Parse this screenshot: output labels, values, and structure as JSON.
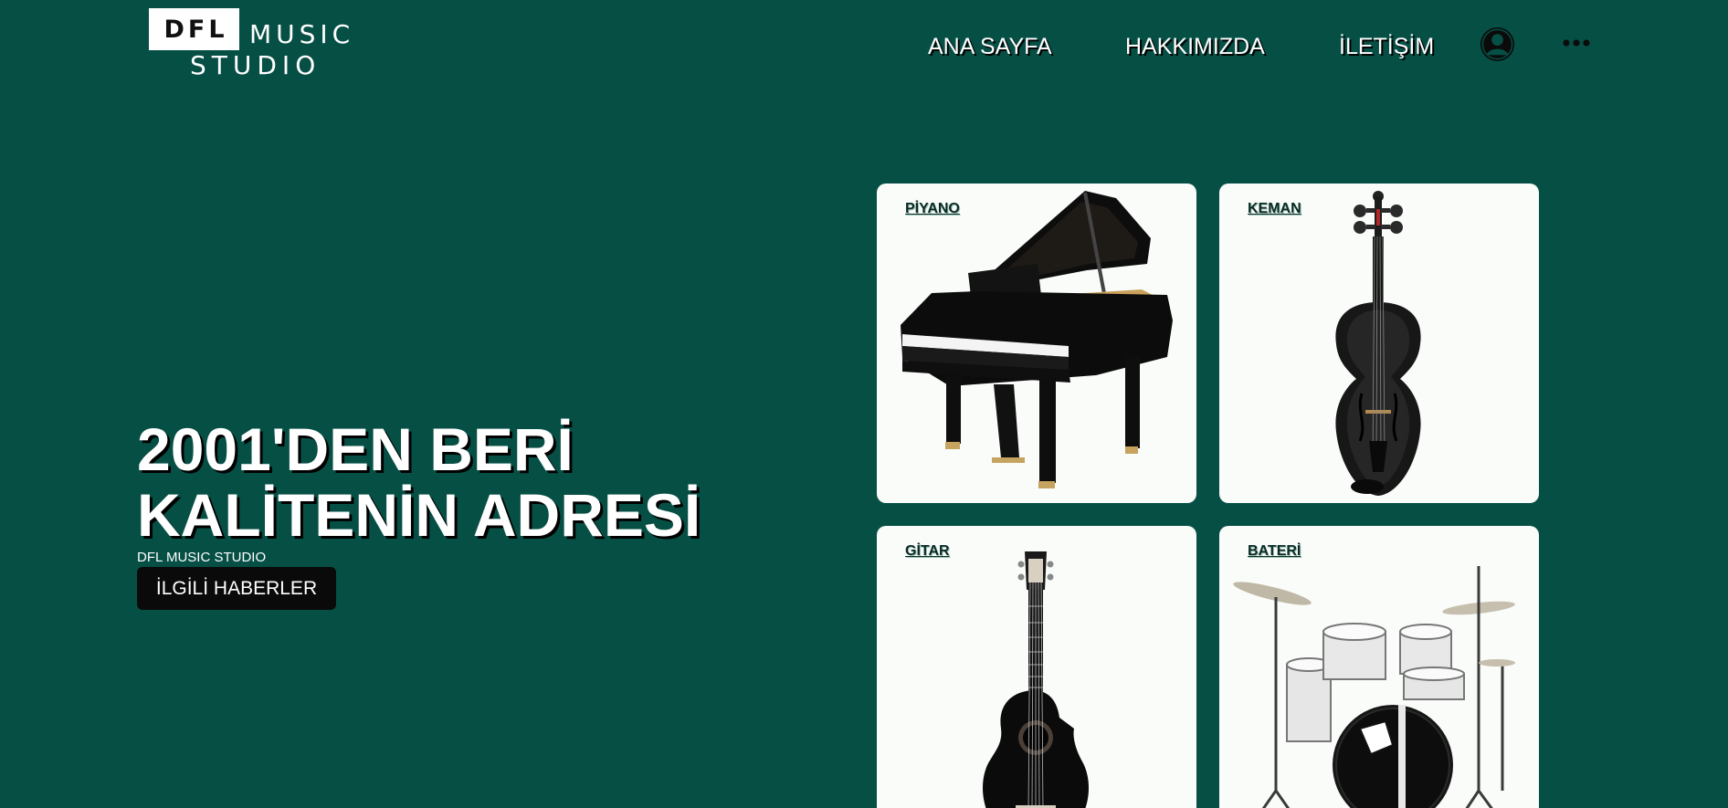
{
  "header": {
    "logo": {
      "box_text": "DFL",
      "line1": "MUSIC",
      "line2": "STUDIO"
    },
    "nav": [
      {
        "label": "ANA SAYFA"
      },
      {
        "label": "HAKKIMIZDA"
      },
      {
        "label": "İLETİŞİM"
      }
    ],
    "icons": {
      "account": "user-account-icon",
      "more": "more-horizontal-icon"
    }
  },
  "hero": {
    "title_line1": "2001'DEN BERİ",
    "title_line2": "KALİTENİN ADRESİ",
    "subtitle": "DFL MUSIC STUDIO",
    "button_label": "İLGİLİ HABERLER"
  },
  "instruments": [
    {
      "label": "PİYANO"
    },
    {
      "label": "KEMAN"
    },
    {
      "label": "GİTAR"
    },
    {
      "label": "BATERİ"
    }
  ],
  "colors": {
    "background": "#064f45",
    "card": "#fafcfa",
    "button": "#0a0a0a",
    "text": "#ffffff"
  }
}
